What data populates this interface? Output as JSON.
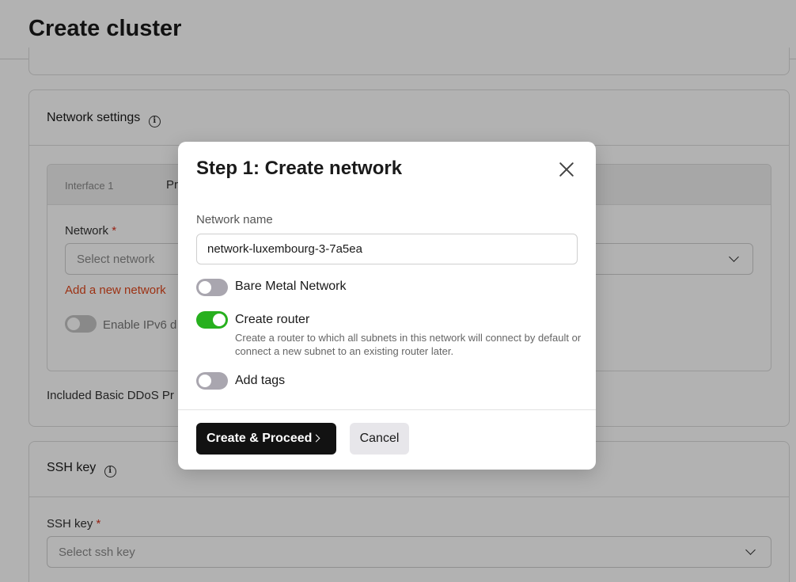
{
  "page": {
    "title": "Create cluster"
  },
  "network_settings": {
    "title": "Network settings",
    "interface_tab": "Interface 1",
    "second_tab_partial": "Pr",
    "network_label": "Network",
    "network_required_mark": "*",
    "network_placeholder": "Select network",
    "add_network_link": "Add a new network",
    "ipv6_label": "Enable IPv6 d",
    "ddos_label": "Included Basic DDoS Pr"
  },
  "ssh": {
    "title": "SSH key",
    "field_label": "SSH key",
    "required_mark": "*",
    "placeholder": "Select ssh key"
  },
  "modal": {
    "title": "Step 1: Create network",
    "network_name_label": "Network name",
    "network_name_value": "network-luxembourg-3-7a5ea",
    "bare_metal_label": "Bare Metal Network",
    "bare_metal_on": false,
    "create_router_label": "Create router",
    "create_router_on": true,
    "create_router_desc": "Create a router to which all subnets in this network will connect by default or connect a new subnet to an existing router later.",
    "add_tags_label": "Add tags",
    "add_tags_on": false,
    "primary_button": "Create & Proceed",
    "cancel_button": "Cancel"
  },
  "colors": {
    "accent_link": "#e0481e",
    "toggle_on": "#27b01e",
    "primary_button": "#121212"
  }
}
